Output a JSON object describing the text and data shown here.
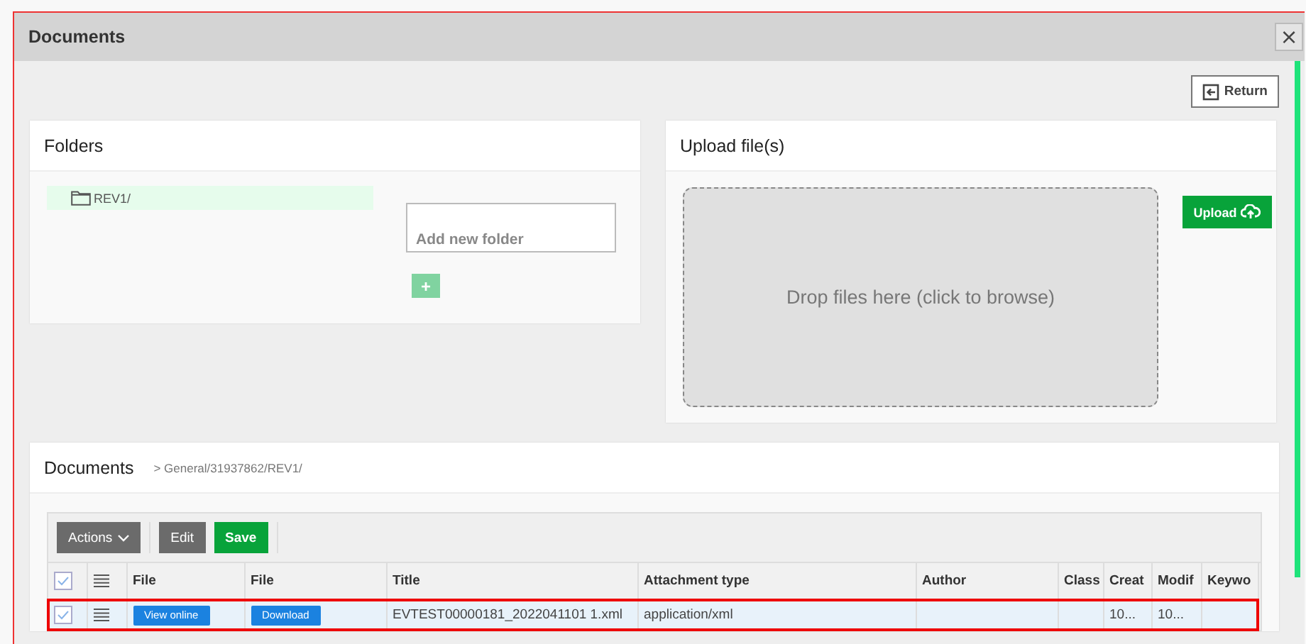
{
  "window": {
    "title": "Documents",
    "close_label": "×"
  },
  "return_button": {
    "label": "Return"
  },
  "folders": {
    "title": "Folders",
    "items": [
      {
        "label": "REV1/",
        "selected": true
      }
    ],
    "new_folder": {
      "placeholder": "Add new folder"
    },
    "add_label": "+"
  },
  "upload": {
    "title": "Upload file(s)",
    "dropzone": "Drop files here (click to browse)",
    "button": "Upload"
  },
  "documents": {
    "title": "Documents",
    "breadcrumb": "> General/31937862/REV1/",
    "toolbar": [
      {
        "label": "Actions",
        "kind": "dropdown"
      },
      {
        "label": "Edit",
        "kind": "plain"
      },
      {
        "label": "Save",
        "kind": "primary"
      }
    ],
    "table": {
      "all_checked": true,
      "columns": [
        {
          "label": "File",
          "kind": "view"
        },
        {
          "label": "File",
          "kind": "download"
        },
        {
          "label": "Title",
          "kind": "text"
        },
        {
          "label": "Attachment type",
          "kind": "text"
        },
        {
          "label": "Author",
          "kind": "text"
        },
        {
          "label": "Class",
          "kind": "text"
        },
        {
          "label": "Creat",
          "kind": "text"
        },
        {
          "label": "Modif",
          "kind": "text"
        },
        {
          "label": "Keywo",
          "kind": "text"
        }
      ],
      "rows": [
        {
          "checked": true,
          "highlighted": true,
          "cells": [
            "View online",
            "Download",
            "EVTEST00000181_2022041101 1.xml",
            "application/xml",
            "",
            "",
            "10...",
            "10...",
            ""
          ]
        }
      ]
    }
  }
}
